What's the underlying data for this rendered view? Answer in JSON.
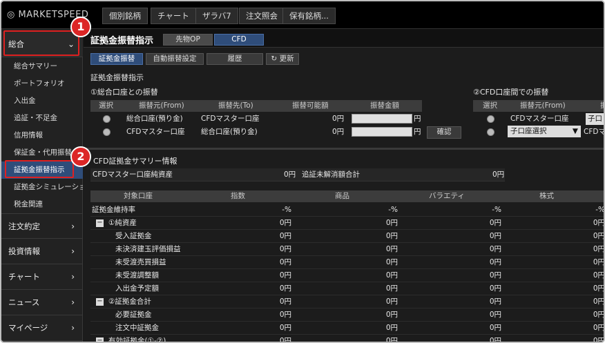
{
  "topbar": {
    "logo": "MARKETSPEED",
    "tabs": [
      "個別銘柄",
      "チャート",
      "ザラバ7",
      "注文照会",
      "保有銘柄..."
    ]
  },
  "sidebar": {
    "section_label": "総合",
    "items": [
      "総合サマリー",
      "ポートフォリオ",
      "入出金",
      "追証・不足金",
      "信用情報",
      "保証金・代用振替",
      "証拠金振替指示",
      "証拠金シミュレーション",
      "税金関連"
    ],
    "bottom": [
      "注文約定",
      "投資情報",
      "チャート",
      "ニュース",
      "マイページ"
    ]
  },
  "main": {
    "title": "証拠金振替指示",
    "title_tabs": [
      "先物OP",
      "CFD"
    ],
    "subtabs": [
      "証拠金振替",
      "自動振替設定",
      "履歴"
    ],
    "refresh": "更新",
    "section_title": "証拠金振替指示",
    "left_label": "①総合口座との振替",
    "right_label": "②CFD口座間での振替",
    "transfer_headers": [
      "選択",
      "振替元(From)",
      "振替先(To)",
      "振替可能額",
      "振替金額"
    ],
    "transfer_rows": [
      {
        "from": "総合口座(預り金)",
        "to": "CFDマスター口座",
        "amount": "0円",
        "unit": "円"
      },
      {
        "from": "CFDマスター口座",
        "to": "総合口座(預り金)",
        "amount": "0円",
        "unit": "円"
      }
    ],
    "confirm": "確認",
    "cfd_headers": [
      "選択",
      "振替元(From)",
      "振"
    ],
    "cfd_rows": [
      {
        "from": "CFDマスター口座",
        "to": "子口"
      },
      {
        "from": "子口座選択",
        "to": "CFDマ"
      }
    ],
    "summary_title": "CFD証拠金サマリー情報",
    "summary_row": {
      "label1": "CFDマスター口座純資産",
      "val1": "0円",
      "label2": "追証未解消額合計",
      "val2": "0円"
    },
    "table_headers": [
      "対象口座",
      "指数",
      "商品",
      "バラエティ",
      "株式"
    ],
    "table_rows": [
      {
        "label": "証拠金維持率",
        "vals": [
          "-%",
          "-%",
          "-%",
          "-%"
        ],
        "indent": 0
      },
      {
        "label": "①純資産",
        "vals": [
          "0円",
          "0円",
          "0円",
          "0円"
        ],
        "indent": 1
      },
      {
        "label": "受入証拠金",
        "vals": [
          "0円",
          "0円",
          "0円",
          "0円"
        ],
        "indent": 2
      },
      {
        "label": "未決済建玉評価損益",
        "vals": [
          "0円",
          "0円",
          "0円",
          "0円"
        ],
        "indent": 2
      },
      {
        "label": "未受渡売買損益",
        "vals": [
          "0円",
          "0円",
          "0円",
          "0円"
        ],
        "indent": 2
      },
      {
        "label": "未受渡調整額",
        "vals": [
          "0円",
          "0円",
          "0円",
          "0円"
        ],
        "indent": 2
      },
      {
        "label": "入出金予定額",
        "vals": [
          "0円",
          "0円",
          "0円",
          "0円"
        ],
        "indent": 2
      },
      {
        "label": "②証拠金合計",
        "vals": [
          "0円",
          "0円",
          "0円",
          "0円"
        ],
        "indent": 1
      },
      {
        "label": "必要証拠金",
        "vals": [
          "0円",
          "0円",
          "0円",
          "0円"
        ],
        "indent": 2
      },
      {
        "label": "注文中証拠金",
        "vals": [
          "0円",
          "0円",
          "0円",
          "0円"
        ],
        "indent": 2
      },
      {
        "label": "有効証拠金(①-②)",
        "vals": [
          "0円",
          "0円",
          "0円",
          "0円"
        ],
        "indent": 1
      }
    ]
  },
  "badges": [
    "1",
    "2"
  ]
}
